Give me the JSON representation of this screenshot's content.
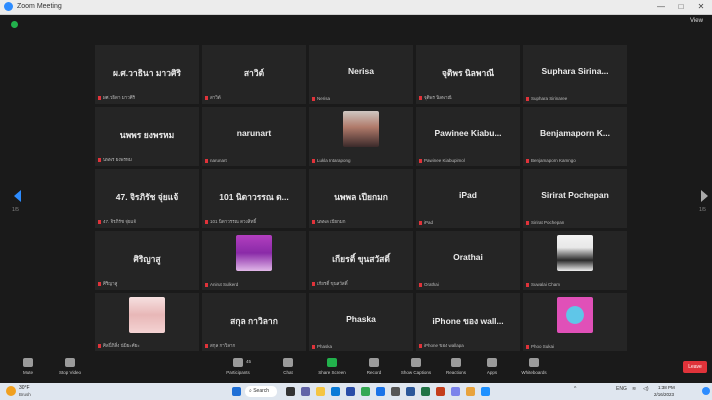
{
  "window": {
    "title": "Zoom Meeting",
    "minimize": "—",
    "maximize": "□",
    "close": "✕"
  },
  "top": {
    "view_label": "View"
  },
  "nav": {
    "left_page": "1/5",
    "right_page": "1/5"
  },
  "tiles": [
    {
      "big": "ผ.ศ.วาธินา มาวศิริ",
      "label": "ผศ.วธิดา มาวศิริ"
    },
    {
      "big": "สาวิต์",
      "label": "สาวิต์"
    },
    {
      "big": "Nerisa",
      "label": "Nerisa"
    },
    {
      "big": "จุติพร นิลพาณี",
      "label": "จุติพร นิลพาณี"
    },
    {
      "big": "Suphara Sirina...",
      "label": "Suphara Sirinaree"
    },
    {
      "big": "นพพร ยงพรหม",
      "label": "นพพร ยงพรหม"
    },
    {
      "big": "narunart",
      "label": "narunart"
    },
    {
      "photo": "photo-woman",
      "label": "Lukla Intarapong"
    },
    {
      "big": "Pawinee Kiabu...",
      "label": "Pawinee Kiabupimol"
    },
    {
      "big": "Benjamaporn K...",
      "label": "Benjamaporn Kamngo"
    },
    {
      "big": "47. จิรภิรัช จุ่ยแจ้",
      "label": "47. จิรภิรัช จุ่ยแจ้"
    },
    {
      "big": "101 นิดาวรรณ ด...",
      "label": "101 นิดาวรรณ ดวงสิทธิ์"
    },
    {
      "big": "นพพล เปียกมก",
      "label": "นพพล เปียกมก"
    },
    {
      "big": "iPad",
      "label": "iPad"
    },
    {
      "big": "Sirirat Pochepan",
      "label": "Sirirat Pochepan"
    },
    {
      "big": "ศิริญาสู",
      "label": "ศิริญาสู"
    },
    {
      "photo": "photo-purple",
      "label": "Anirut Sulkerd"
    },
    {
      "big": "เกียรติ์ ขุนสวัสดิ์",
      "label": "เกียรติ์ ขุนสวัสดิ์"
    },
    {
      "big": "Orathai",
      "label": "Orathai"
    },
    {
      "photo": "photo-man",
      "label": "Suwalai Cham"
    },
    {
      "photo": "photo-girl",
      "label": "ศิลปิ์ภิสิ๋ง นัมิยะศ์ยะ"
    },
    {
      "big": "สกุล กาวิลาก",
      "label": "สกุล กาวิลาก"
    },
    {
      "big": "Phaska",
      "label": "Phaska"
    },
    {
      "big": "iPhone ของ wall...",
      "label": "iPhone ของ wallapa"
    },
    {
      "photo": "photo-circle",
      "label": "Phoo Sukai"
    }
  ],
  "toolbar": {
    "mute": "Mute",
    "stop_video": "Stop Video",
    "participants": "Participants",
    "participants_count": "45",
    "chat": "Chat",
    "share_screen": "Share Screen",
    "record": "Record",
    "show_captions": "Show Captions",
    "reactions": "Reactions",
    "apps": "Apps",
    "whiteboards": "Whiteboards",
    "leave": "Leave"
  },
  "taskbar": {
    "weather_temp": "30°F",
    "weather_desc": "Brush",
    "search": "Search",
    "tray_lang": "ENG",
    "time": "1:38 PM",
    "date": "2/16/2023"
  },
  "colors": {
    "accent": "#2d8cff",
    "leave": "#e0333a",
    "share": "#22b14c"
  }
}
